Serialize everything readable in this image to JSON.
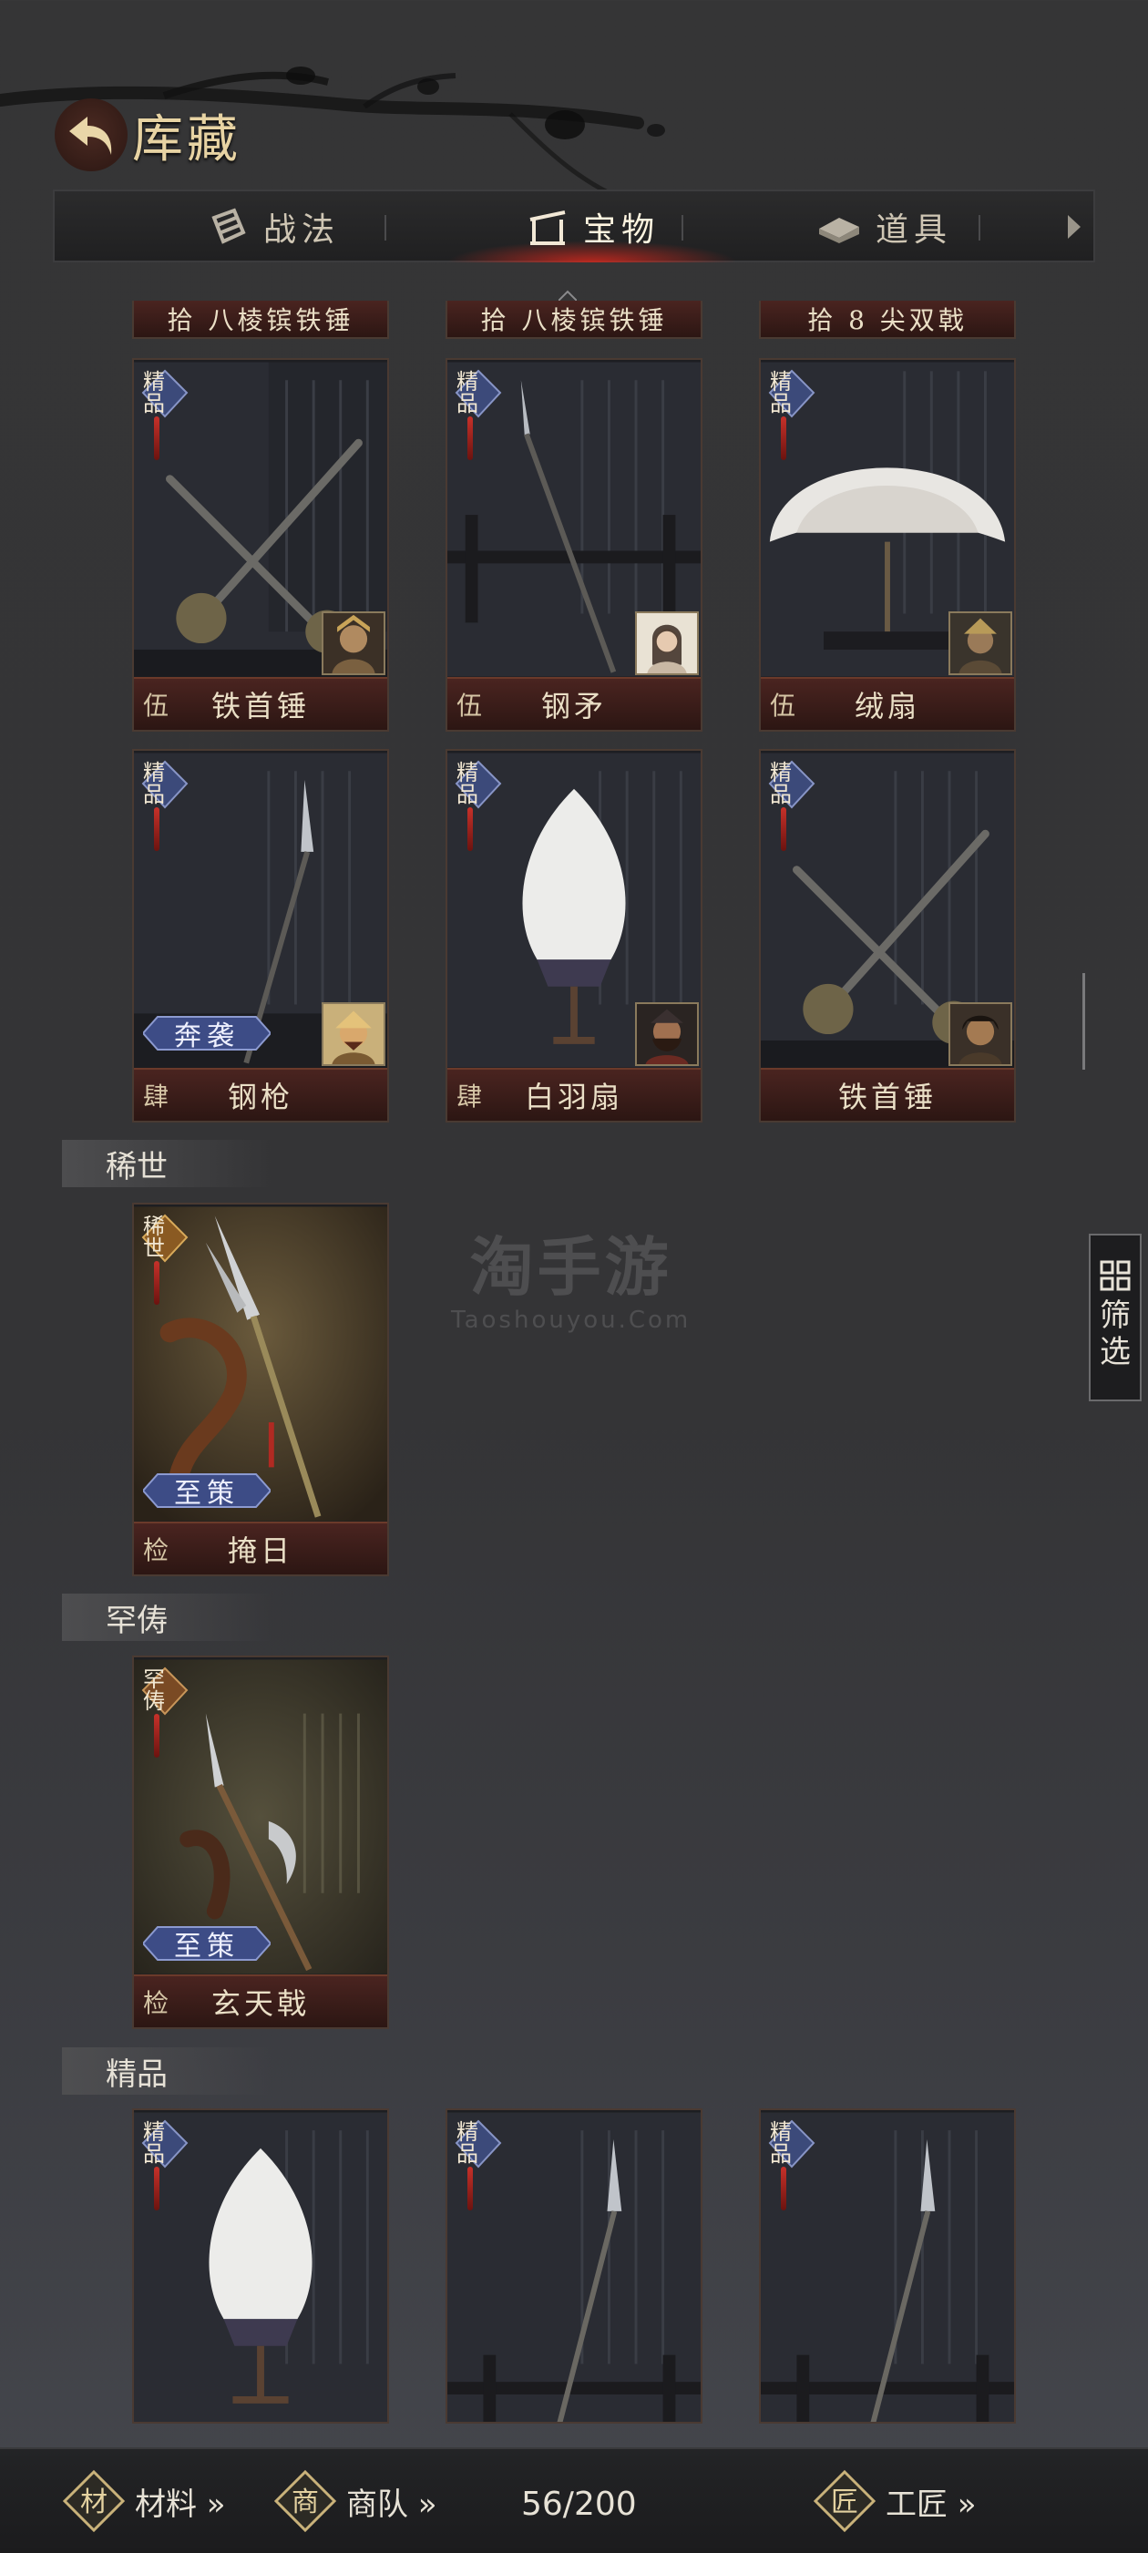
{
  "header": {
    "title": "库藏"
  },
  "tabs": [
    {
      "label": "战法",
      "icon": "scroll-icon"
    },
    {
      "label": "宝物",
      "icon": "weapon-rack-icon",
      "active": true
    },
    {
      "label": "道具",
      "icon": "ingot-icon"
    }
  ],
  "top_row_partial": [
    "拾 八棱镔铁锤",
    "拾 八棱镔铁锤",
    "拾 8 尖双戟"
  ],
  "grade_badges": {
    "jingpin": "精品",
    "xishi": "稀世",
    "hanchou": "罕俦"
  },
  "cards_row1": [
    {
      "level": "伍",
      "name": "铁首锤"
    },
    {
      "level": "伍",
      "name": "钢矛"
    },
    {
      "level": "伍",
      "name": "绒扇"
    }
  ],
  "cards_row2": [
    {
      "level": "肆",
      "name": "钢枪",
      "tag": "奔袭"
    },
    {
      "level": "肆",
      "name": "白羽扇"
    },
    {
      "level": "",
      "name": "铁首锤"
    }
  ],
  "sections": {
    "xishi": "稀世",
    "hanchou": "罕俦",
    "jingpin": "精品"
  },
  "xishi_card": {
    "level": "检",
    "name": "掩日",
    "tag": "至策"
  },
  "hanchou_card": {
    "level": "检",
    "name": "玄天戟",
    "tag": "至策"
  },
  "watermark": {
    "line1": "淘手游",
    "line2": "Taoshouyou.Com"
  },
  "filter_label": "筛选",
  "bottom": {
    "materials": "材料 »",
    "caravan": "商队 »",
    "count": "56/200",
    "artisan": "工匠 »",
    "icon_materials": "材",
    "icon_caravan": "商",
    "icon_artisan": "匠"
  }
}
